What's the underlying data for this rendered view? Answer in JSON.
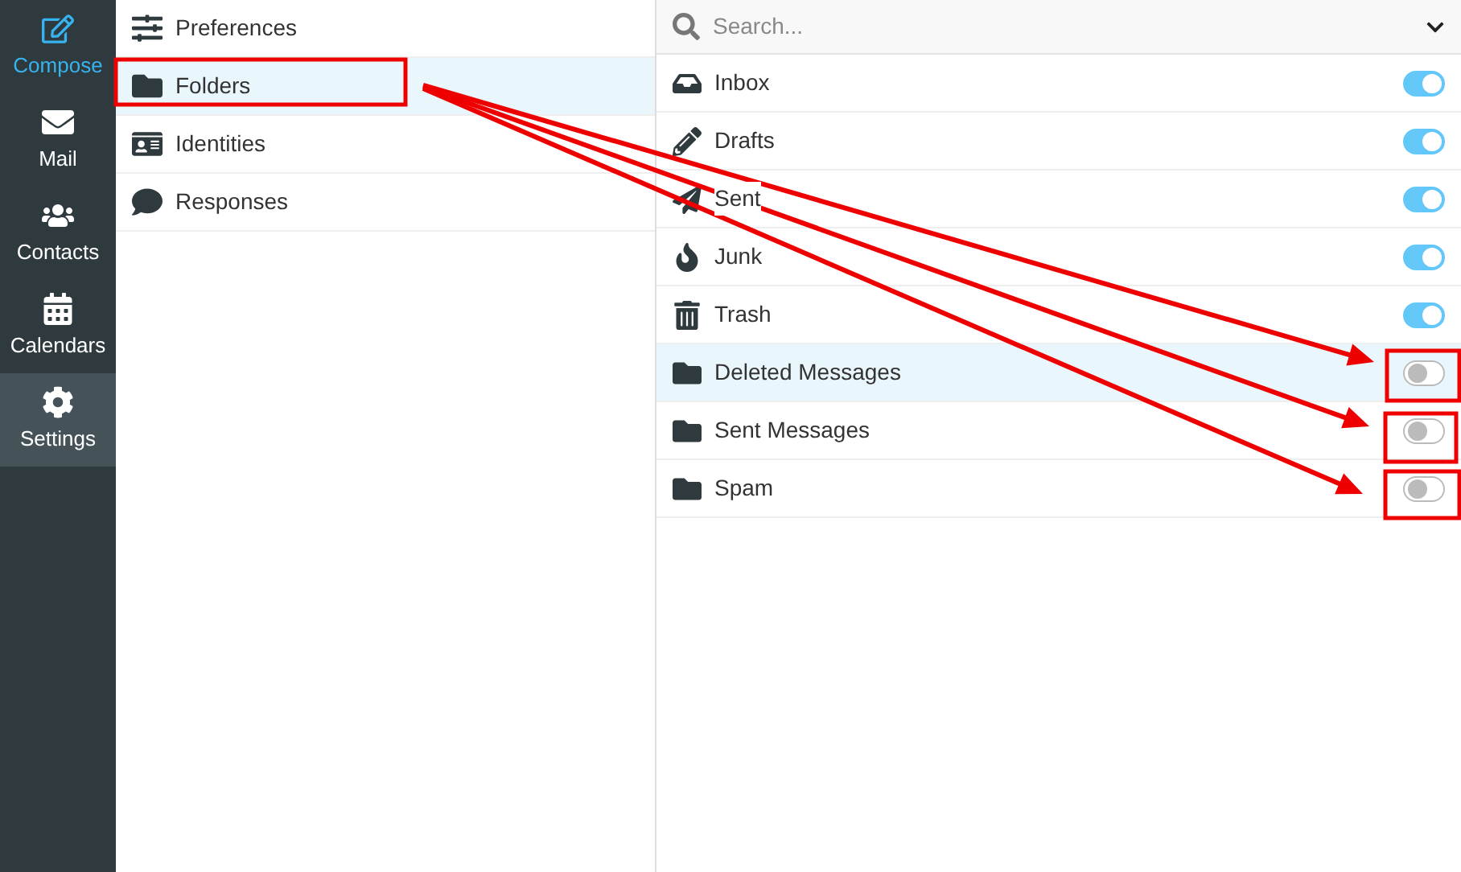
{
  "nav": [
    {
      "label": "Compose",
      "kind": "action",
      "selected": false
    },
    {
      "label": "Mail",
      "kind": "mail",
      "selected": false
    },
    {
      "label": "Contacts",
      "kind": "contacts",
      "selected": false
    },
    {
      "label": "Calendars",
      "kind": "calendars",
      "selected": false
    },
    {
      "label": "Settings",
      "kind": "settings",
      "selected": true
    }
  ],
  "settings_sections": [
    {
      "label": "Preferences",
      "kind": "preferences",
      "selected": false
    },
    {
      "label": "Folders",
      "kind": "folders",
      "selected": true
    },
    {
      "label": "Identities",
      "kind": "identities",
      "selected": false
    },
    {
      "label": "Responses",
      "kind": "responses",
      "selected": false
    }
  ],
  "search": {
    "placeholder": "Search..."
  },
  "folders": [
    {
      "name": "Inbox",
      "kind": "inbox",
      "on": true,
      "selected": false
    },
    {
      "name": "Drafts",
      "kind": "drafts",
      "on": true,
      "selected": false
    },
    {
      "name": "Sent",
      "kind": "sent",
      "on": true,
      "selected": false
    },
    {
      "name": "Junk",
      "kind": "junk",
      "on": true,
      "selected": false
    },
    {
      "name": "Trash",
      "kind": "trash",
      "on": true,
      "selected": false
    },
    {
      "name": "Deleted Messages",
      "kind": "folder",
      "on": false,
      "selected": true
    },
    {
      "name": "Sent Messages",
      "kind": "folder",
      "on": false,
      "selected": false
    },
    {
      "name": "Spam",
      "kind": "folder",
      "on": false,
      "selected": false
    }
  ]
}
